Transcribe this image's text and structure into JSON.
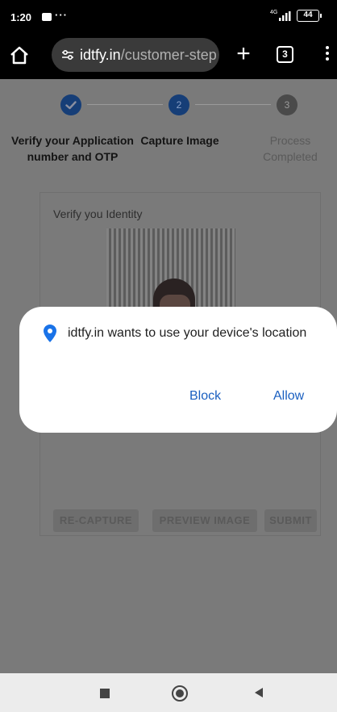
{
  "status_bar": {
    "time": "1:20",
    "overflow": "···",
    "network": "4G",
    "battery": "44"
  },
  "browser": {
    "url_host": "idtfy.in",
    "url_path": "/customer-step",
    "tab_count": "3",
    "icons": [
      "home-icon",
      "site-settings-icon",
      "plus-icon",
      "tab-switcher-icon",
      "more-vert-icon"
    ]
  },
  "stepper": {
    "steps": [
      {
        "number": "",
        "label": "Verify your Application number and OTP",
        "state": "done"
      },
      {
        "number": "2",
        "label": "Capture Image",
        "state": "active"
      },
      {
        "number": "3",
        "label": "Process Completed",
        "state": "pending"
      }
    ]
  },
  "card": {
    "title": "Verify you Identity",
    "buttons": {
      "recapture": "RE-CAPTURE",
      "preview": "PREVIEW IMAGE",
      "submit": "SUBMIT"
    }
  },
  "dialog": {
    "message": "idtfy.in wants to use your device's location",
    "block_label": "Block",
    "allow_label": "Allow",
    "icon": "location-pin-icon"
  },
  "colors": {
    "dialog_button": "#1a5fc0",
    "location_pin": "#1a73e8",
    "step_active": "#163e77"
  }
}
